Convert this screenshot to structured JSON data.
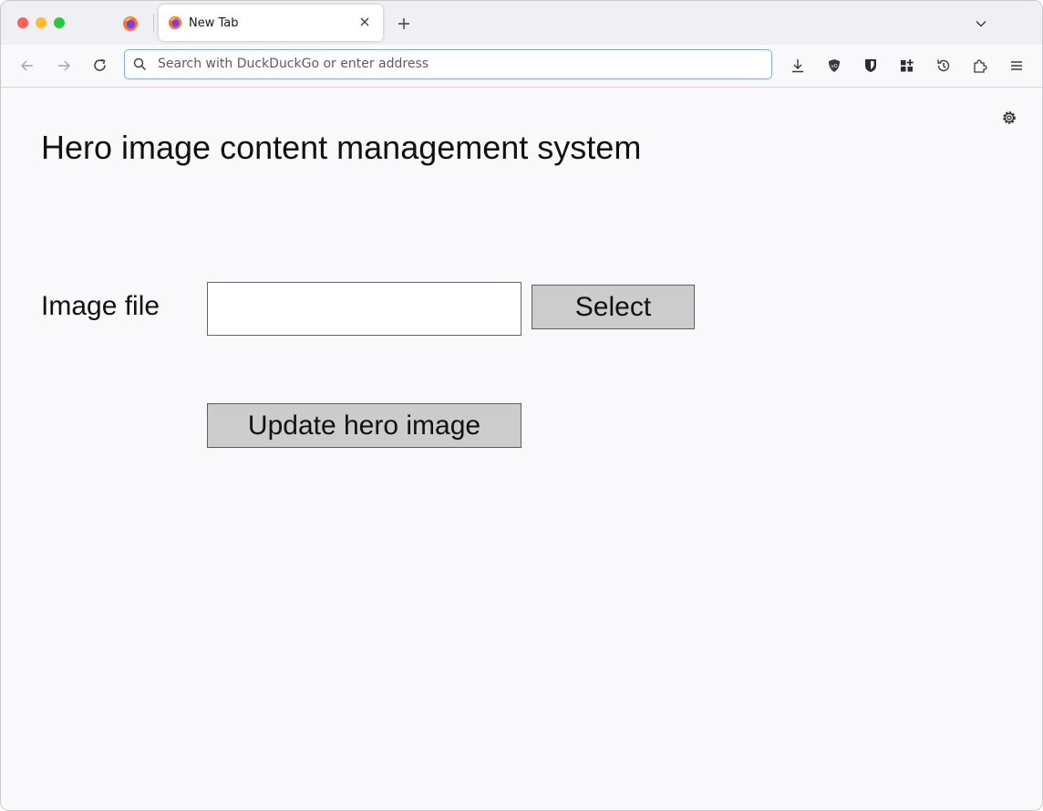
{
  "browser": {
    "tab": {
      "title": "New Tab"
    },
    "urlbar": {
      "placeholder": "Search with DuckDuckGo or enter address",
      "value": ""
    }
  },
  "page": {
    "title": "Hero image content management system",
    "image_field": {
      "label": "Image file",
      "value": ""
    },
    "select_button": "Select",
    "update_button": "Update hero image"
  },
  "colors": {
    "button_bg": "#cccccc",
    "page_bg": "#f9f9fb",
    "urlbar_focus": "#88a8e0"
  }
}
